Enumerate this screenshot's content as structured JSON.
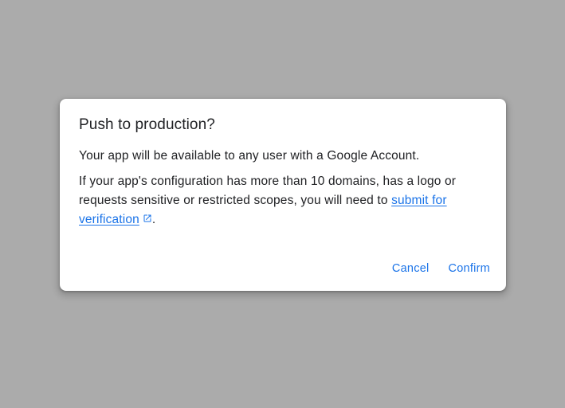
{
  "dialog": {
    "title": "Push to production?",
    "paragraph1": "Your app will be available to any user with a Google Account.",
    "paragraph2_text": "If your app's configuration has more than 10 domains, has a logo or requests sensitive or restricted scopes, you will need to ",
    "paragraph2_link": "submit for verification",
    "paragraph2_end": ".",
    "link_icon": "external-link-icon",
    "cancel_label": "Cancel",
    "confirm_label": "Confirm"
  },
  "colors": {
    "overlay": "#ababab",
    "accent": "#1a73e8",
    "text": "#202124"
  }
}
